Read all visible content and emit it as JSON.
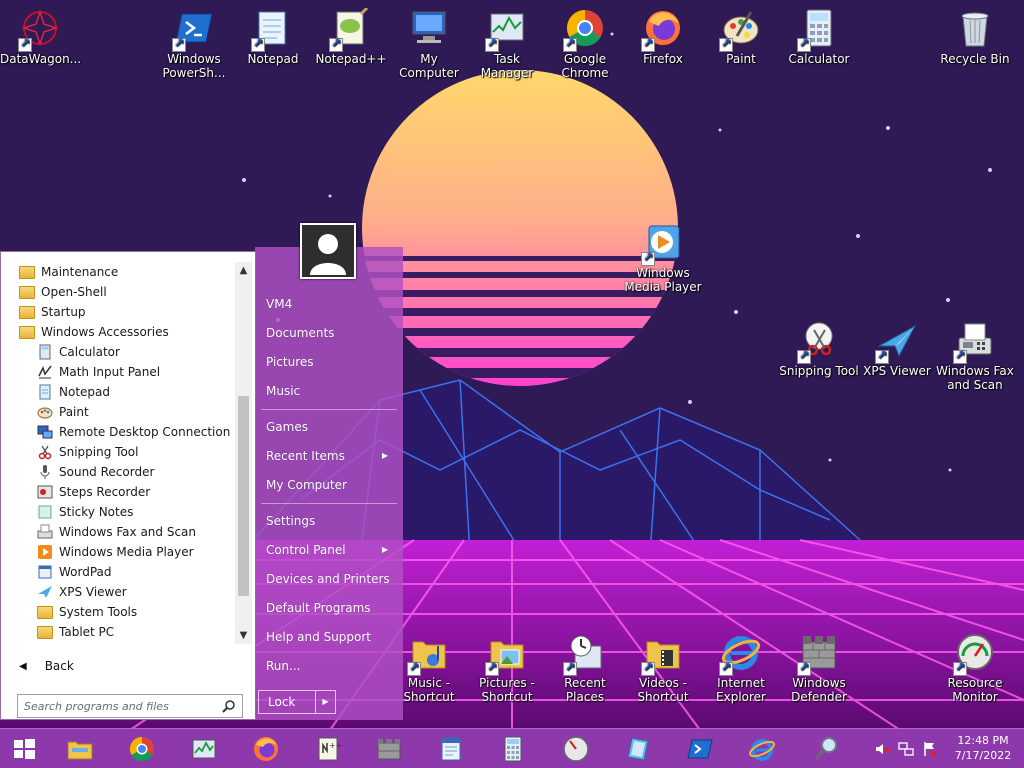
{
  "desktop": {
    "icons": [
      {
        "label": "DataWagon...",
        "icon": "datawagon-icon"
      },
      {
        "label": "Windows PowerSh...",
        "icon": "powershell-icon"
      },
      {
        "label": "Notepad",
        "icon": "notepad-icon"
      },
      {
        "label": "Notepad++",
        "icon": "notepadpp-icon"
      },
      {
        "label": "My Computer",
        "icon": "computer-icon"
      },
      {
        "label": "Task Manager",
        "icon": "task-manager-icon"
      },
      {
        "label": "Google Chrome",
        "icon": "chrome-icon"
      },
      {
        "label": "Firefox",
        "icon": "firefox-icon"
      },
      {
        "label": "Paint",
        "icon": "paint-icon"
      },
      {
        "label": "Calculator",
        "icon": "calculator-icon"
      },
      {
        "label": "Recycle Bin",
        "icon": "recycle-bin-icon"
      },
      {
        "label": "Windows Media Player",
        "icon": "media-player-icon"
      },
      {
        "label": "Snipping Tool",
        "icon": "snipping-tool-icon"
      },
      {
        "label": "XPS Viewer",
        "icon": "xps-viewer-icon"
      },
      {
        "label": "Windows Fax and Scan",
        "icon": "fax-icon"
      },
      {
        "label": "Music - Shortcut",
        "icon": "music-folder-icon"
      },
      {
        "label": "Pictures - Shortcut",
        "icon": "pictures-folder-icon"
      },
      {
        "label": "Recent Places",
        "icon": "recent-places-icon"
      },
      {
        "label": "Videos - Shortcut",
        "icon": "videos-folder-icon"
      },
      {
        "label": "Internet Explorer",
        "icon": "ie-icon"
      },
      {
        "label": "Windows Defender",
        "icon": "defender-icon"
      },
      {
        "label": "Resource Monitor",
        "icon": "resource-monitor-icon"
      }
    ]
  },
  "start_menu": {
    "programs": [
      {
        "label": "Maintenance",
        "type": "folder"
      },
      {
        "label": "Open-Shell",
        "type": "folder"
      },
      {
        "label": "Startup",
        "type": "folder"
      },
      {
        "label": "Windows Accessories",
        "type": "folder"
      },
      {
        "label": "Calculator",
        "type": "app"
      },
      {
        "label": "Math Input Panel",
        "type": "app"
      },
      {
        "label": "Notepad",
        "type": "app"
      },
      {
        "label": "Paint",
        "type": "app"
      },
      {
        "label": "Remote Desktop Connection",
        "type": "app"
      },
      {
        "label": "Snipping Tool",
        "type": "app"
      },
      {
        "label": "Sound Recorder",
        "type": "app"
      },
      {
        "label": "Steps Recorder",
        "type": "app"
      },
      {
        "label": "Sticky Notes",
        "type": "app"
      },
      {
        "label": "Windows Fax and Scan",
        "type": "app"
      },
      {
        "label": "Windows Media Player",
        "type": "app"
      },
      {
        "label": "WordPad",
        "type": "app"
      },
      {
        "label": "XPS Viewer",
        "type": "app"
      },
      {
        "label": "System Tools",
        "type": "folder"
      },
      {
        "label": "Tablet PC",
        "type": "folder"
      }
    ],
    "back_label": "Back",
    "search_placeholder": "Search programs and files",
    "right": {
      "user": "VM4",
      "documents": "Documents",
      "pictures": "Pictures",
      "music": "Music",
      "games": "Games",
      "recent_items": "Recent Items",
      "my_computer": "My Computer",
      "settings": "Settings",
      "control_panel": "Control Panel",
      "devices": "Devices and Printers",
      "default_programs": "Default Programs",
      "help": "Help and Support",
      "run": "Run...",
      "lock": "Lock"
    }
  },
  "taskbar": {
    "time": "12:48 PM",
    "date": "7/17/2022"
  },
  "colors": {
    "menu_right": "#b050c4",
    "taskbar": "#963cb4",
    "sun_top": "#ffe066",
    "sun_bottom": "#ff4fd8"
  }
}
